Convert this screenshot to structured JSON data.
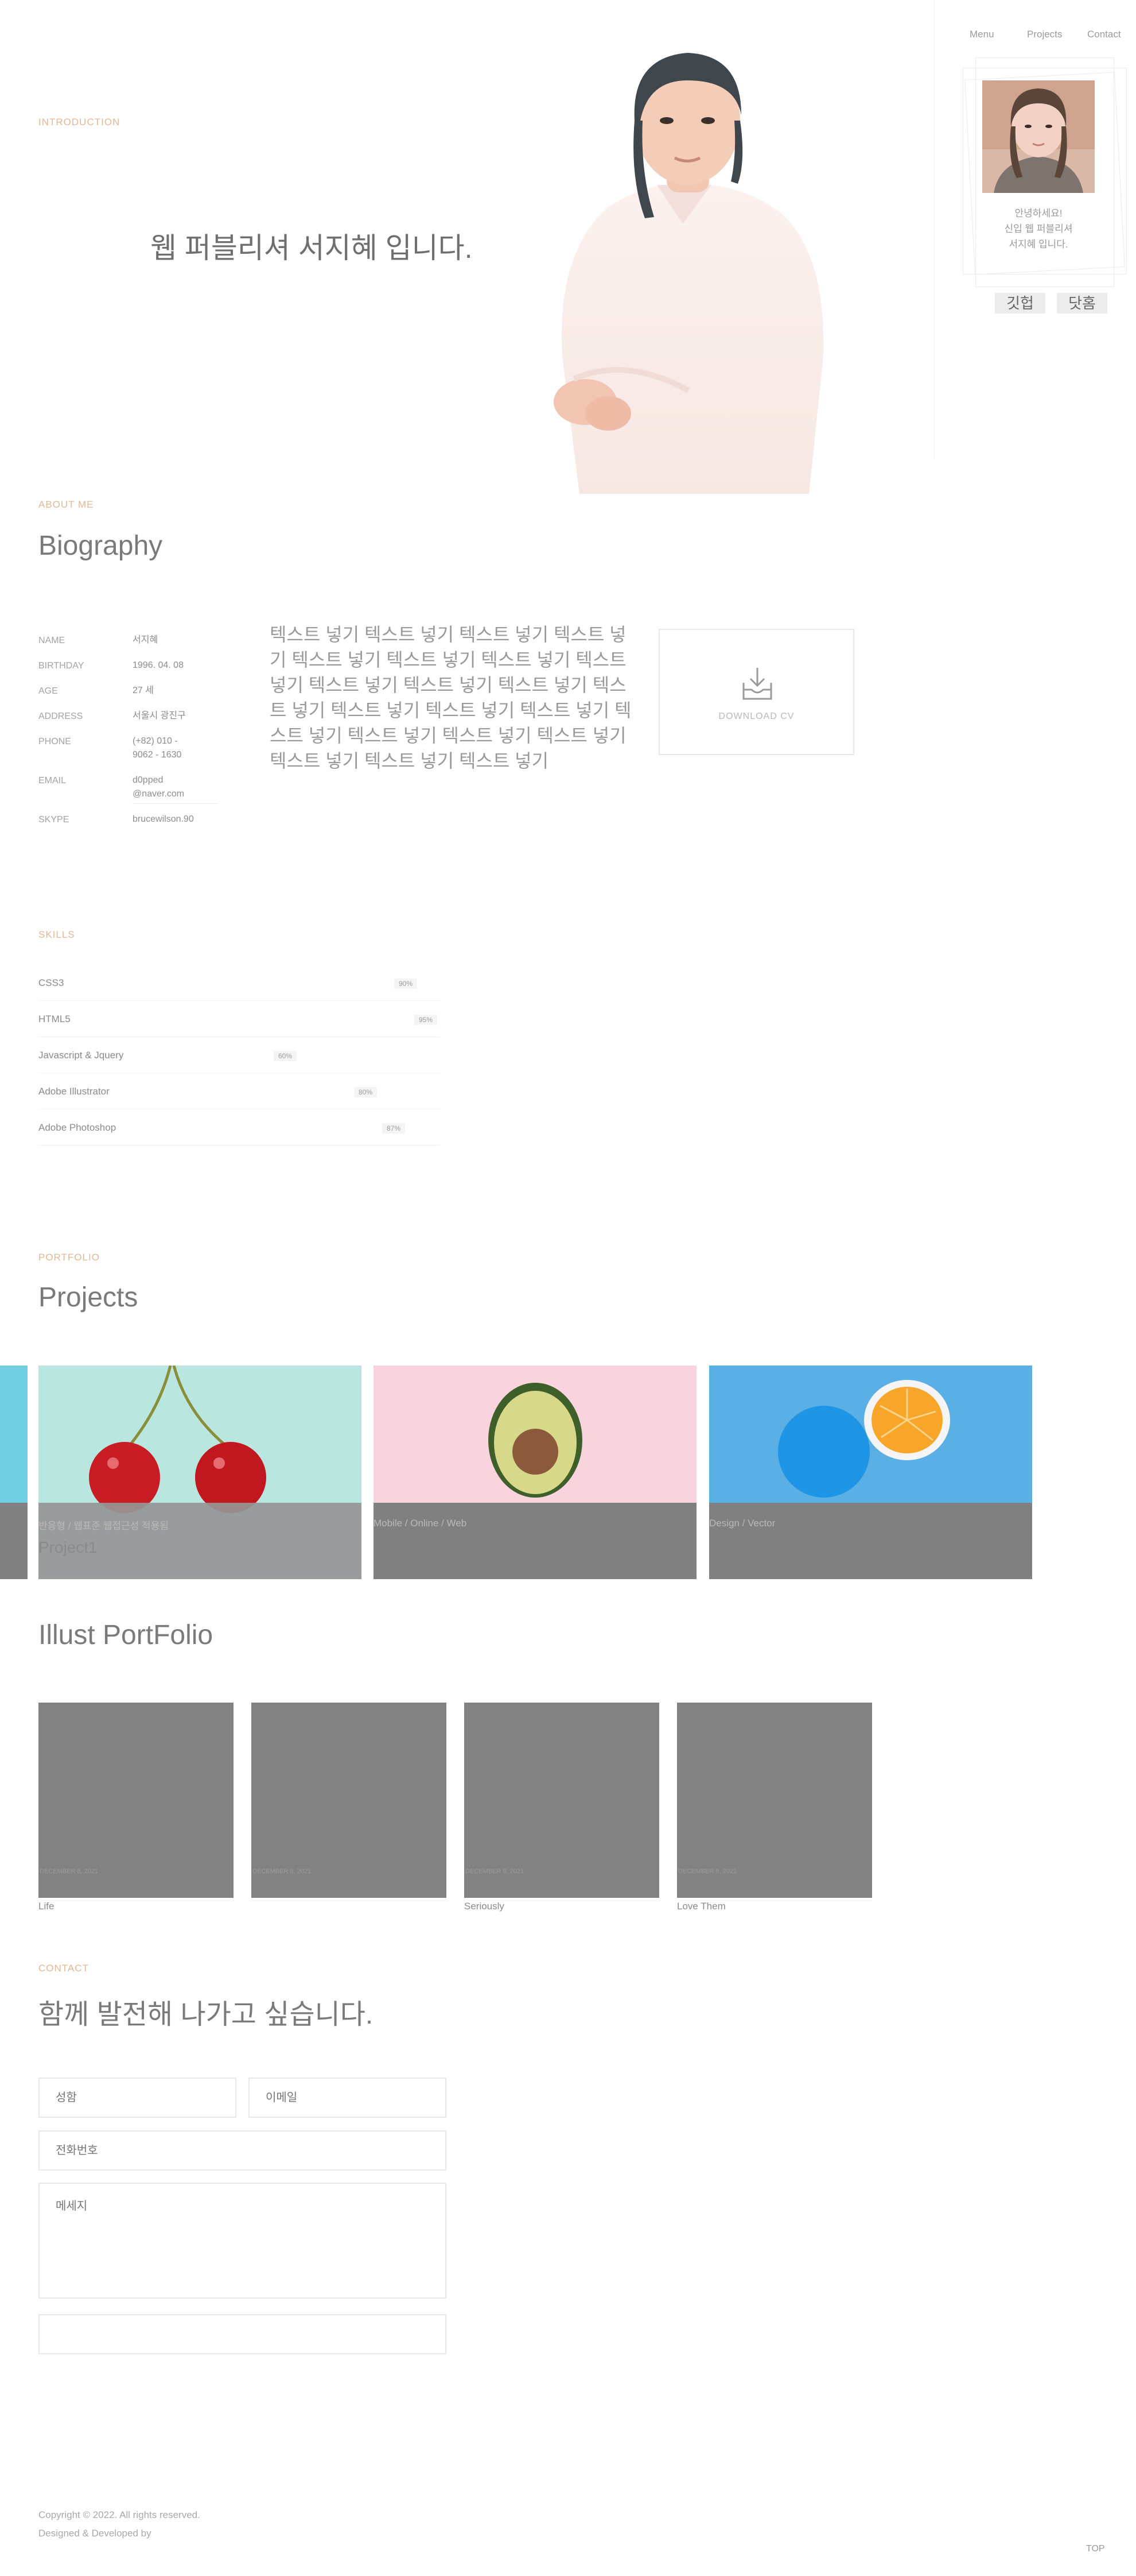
{
  "nav": {
    "links": [
      "Menu",
      "Projects",
      "Contact"
    ]
  },
  "side_panel": {
    "greeting_lines": [
      "안녕하세요!",
      "신입 웹 퍼블리셔",
      "서지혜 입니다."
    ],
    "buttons": [
      "깃헙",
      "닷홈"
    ]
  },
  "hero": {
    "eyebrow": "INTRODUCTION",
    "title": "웹 퍼블리셔 서지혜 입니다."
  },
  "about": {
    "eyebrow": "ABOUT ME",
    "title": "Biography",
    "info": [
      {
        "label": "NAME",
        "value": "서지혜"
      },
      {
        "label": "BIRTHDAY",
        "value": "1996. 04. 08"
      },
      {
        "label": "AGE",
        "value": "27 세"
      },
      {
        "label": "ADDRESS",
        "value": "서울시 광진구"
      },
      {
        "label": "PHONE",
        "value": "(+82) 010 -\n9062 - 1630"
      },
      {
        "label": "EMAIL",
        "value": "d0pped\n@naver.com"
      },
      {
        "label": "SKYPE",
        "value": "brucewilson.90"
      }
    ],
    "text": "텍스트 넣기 텍스트 넣기 텍스트 넣기 텍스트 넣기 텍스트 넣기 텍스트 넣기 텍스트 넣기 텍스트 넣기 텍스트 넣기 텍스트 넣기 텍스트 넣기 텍스트 넣기 텍스트 넣기 텍스트 넣기 텍스트 넣기 텍스트 넣기 텍스트 넣기 텍스트 넣기 텍스트 넣기 텍스트 넣기 텍스트 넣기 텍스트 넣기",
    "cv_label": "DOWNLOAD CV"
  },
  "skills": {
    "eyebrow": "SKILLS",
    "items": [
      {
        "name": "CSS3",
        "percent": "90%",
        "level": 0.9
      },
      {
        "name": "HTML5",
        "percent": "95%",
        "level": 0.95
      },
      {
        "name": "Javascript & Jquery",
        "percent": "60%",
        "level": 0.6
      },
      {
        "name": "Adobe Illustrator",
        "percent": "80%",
        "level": 0.8
      },
      {
        "name": "Adobe Photoshop",
        "percent": "87%",
        "level": 0.87
      }
    ]
  },
  "portfolio": {
    "eyebrow": "PORTFOLIO",
    "title": "Projects",
    "projects": [
      {
        "category": "반응형 / 웹표준 웹접근성 적용됨",
        "title": "Project1",
        "bg": "#b5e3dd"
      },
      {
        "category": "Mobile / Online / Web",
        "title": "",
        "bg": "#f7d1dd"
      },
      {
        "category": "Design / Vector",
        "title": "",
        "bg": "#5aaee3"
      }
    ]
  },
  "illust": {
    "title": "Illust PortFolio",
    "items": [
      {
        "date": "DECEMBER 8, 2021",
        "title": "Life"
      },
      {
        "date": "DECEMBER 8, 2021",
        "title": ""
      },
      {
        "date": "DECEMBER 8, 2021",
        "title": "Seriously"
      },
      {
        "date": "DECEMBER 8, 2021",
        "title": "Love Them"
      }
    ]
  },
  "contact": {
    "eyebrow": "CONTACT",
    "title": "함께 발전해 나가고 싶습니다.",
    "name_placeholder": "성함",
    "email_placeholder": "이메일",
    "phone_placeholder": "전화번호",
    "message_placeholder": "메세지"
  },
  "footer": {
    "copyright": "Copyright © 2022. All rights reserved.",
    "credit": "Designed & Developed by",
    "top_label": "TOP"
  },
  "colors": {
    "accent": "#e2b796",
    "overlay": "#8a8a8a"
  }
}
